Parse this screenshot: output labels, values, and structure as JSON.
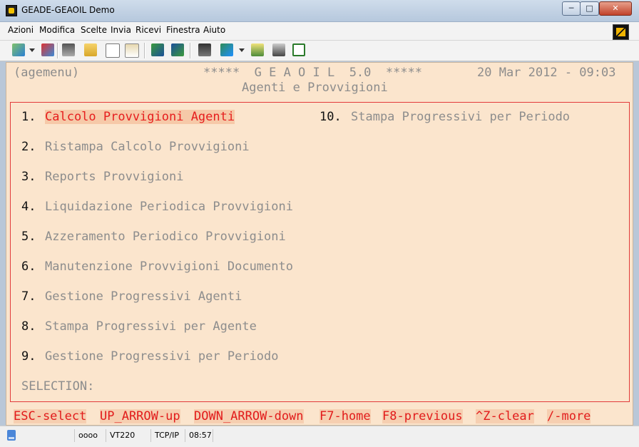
{
  "window": {
    "title": "GEADE-GEAOIL Demo",
    "minimize": "─",
    "maximize": "□",
    "close": "✕"
  },
  "menubar": {
    "items": [
      "Azioni",
      "Modifica",
      "Scelte",
      "Invia",
      "Ricevi",
      "Finestra",
      "Aiuto"
    ]
  },
  "toolbar": {
    "icons": [
      "new-session-icon",
      "open-icon",
      "print-icon",
      "folder-icon",
      "copy-icon",
      "paste-icon",
      "send-icon",
      "receive-icon",
      "book-icon",
      "font-icon",
      "macro-icon",
      "settings-icon",
      "screen-icon"
    ]
  },
  "terminal": {
    "program": "(agemenu)",
    "app_title": "*****  G E A O I L  5.0  *****",
    "datetime": "20 Mar 2012 - 09:03",
    "subtitle": "Agenti e Provvigioni",
    "menu": [
      {
        "num": "1.",
        "label": "Calcolo Provvigioni Agenti",
        "selected": true
      },
      {
        "num": "2.",
        "label": "Ristampa Calcolo Provvigioni",
        "selected": false
      },
      {
        "num": "3.",
        "label": "Reports Provvigioni",
        "selected": false
      },
      {
        "num": "4.",
        "label": "Liquidazione Periodica Provvigioni",
        "selected": false
      },
      {
        "num": "5.",
        "label": "Azzeramento Periodico Provvigioni",
        "selected": false
      },
      {
        "num": "6.",
        "label": "Manutenzione Provvigioni Documento",
        "selected": false
      },
      {
        "num": "7.",
        "label": "Gestione Progressivi Agenti",
        "selected": false
      },
      {
        "num": "8.",
        "label": "Stampa Progressivi per Agente",
        "selected": false
      },
      {
        "num": "9.",
        "label": "Gestione Progressivi per Periodo",
        "selected": false
      },
      {
        "num": "10.",
        "label": "Stampa Progressivi per Periodo",
        "selected": false
      }
    ],
    "selection_label": "SELECTION:",
    "footer_keys": [
      "ESC-select",
      "UP_ARROW-up",
      "DOWN_ARROW-down",
      "F7-home",
      "F8-previous",
      "^Z-clear",
      "/-more"
    ]
  },
  "statusbar": {
    "indicators": "oooo",
    "terminal_type": "VT220",
    "protocol": "TCP/IP",
    "time": "08:57"
  },
  "colors": {
    "terminal_bg": "#fbe5cd",
    "highlight_text": "#e61e1e",
    "box_border": "#e23a3a",
    "menu_text": "#8d8d8d"
  }
}
